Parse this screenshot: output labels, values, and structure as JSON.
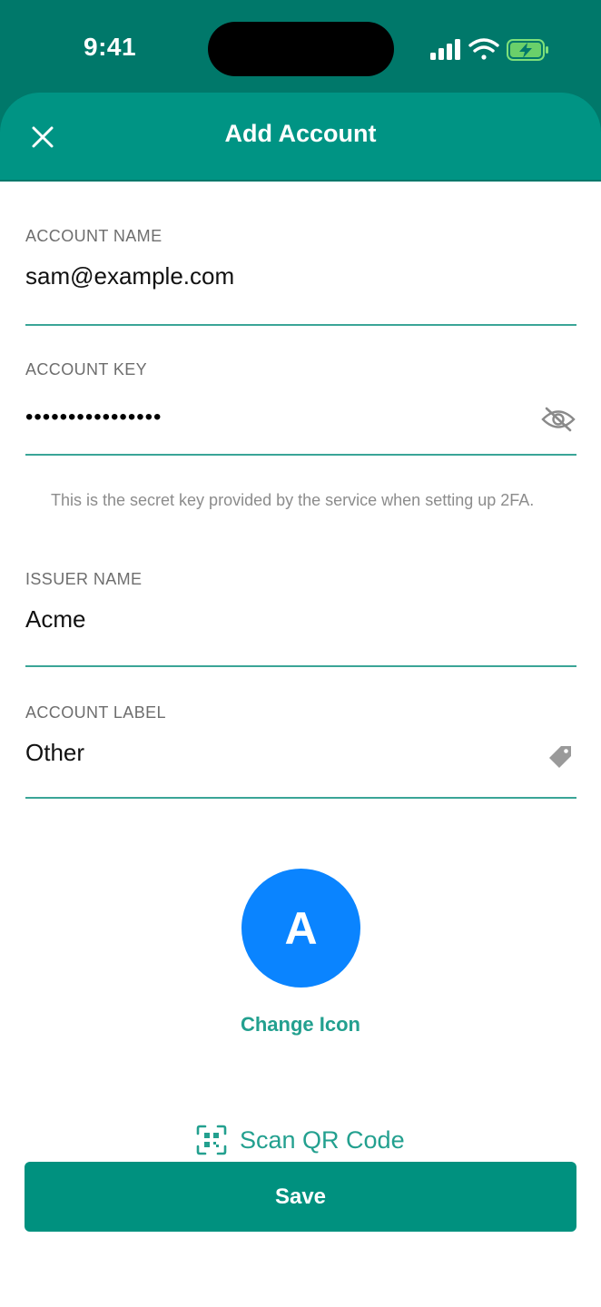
{
  "status_bar": {
    "time": "9:41",
    "icons": [
      "cellular-signal-icon",
      "wifi-icon",
      "battery-charging-icon"
    ]
  },
  "header": {
    "title": "Add Account",
    "close_icon": "close-icon"
  },
  "form": {
    "account_name": {
      "label": "ACCOUNT NAME",
      "value": "sam@example.com"
    },
    "account_key": {
      "label": "ACCOUNT KEY",
      "masked_value": "••••••••••••••••",
      "toggle_icon": "eye-slash-icon",
      "helper": "This is the secret key provided by the service when setting up 2FA."
    },
    "issuer_name": {
      "label": "ISSUER NAME",
      "value": "Acme"
    },
    "account_label": {
      "label": "ACCOUNT LABEL",
      "value": "Other",
      "icon": "tag-icon"
    }
  },
  "icon_section": {
    "avatar_letter": "A",
    "avatar_color": "#0a84ff",
    "change_icon_label": "Change Icon"
  },
  "actions": {
    "scan_qr_label": "Scan QR Code",
    "save_label": "Save"
  },
  "colors": {
    "status_bar": "#00786a",
    "header": "#009484",
    "accent": "#23a08f",
    "primary_button": "#00917f"
  }
}
